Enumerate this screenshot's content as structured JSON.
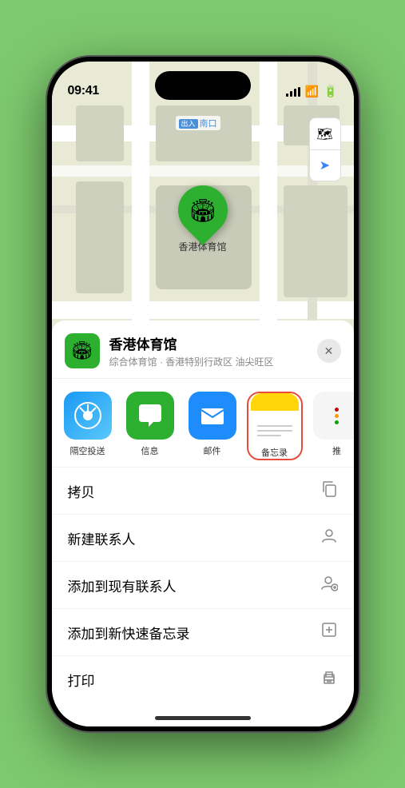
{
  "statusBar": {
    "time": "09:41",
    "timeIcon": "▶"
  },
  "mapLabel": "南口",
  "mapLabelPrefix": "出入",
  "locationPin": {
    "label": "香港体育馆",
    "emoji": "🏟"
  },
  "mapControls": {
    "mapIcon": "🗺",
    "locationIcon": "➤"
  },
  "locationHeader": {
    "name": "香港体育馆",
    "subtitle": "综合体育馆 · 香港特别行政区 油尖旺区",
    "closeLabel": "✕"
  },
  "shareApps": [
    {
      "id": "airdrop",
      "label": "隔空投送",
      "type": "airdrop"
    },
    {
      "id": "messages",
      "label": "信息",
      "type": "messages"
    },
    {
      "id": "mail",
      "label": "邮件",
      "type": "mail"
    },
    {
      "id": "notes",
      "label": "备忘录",
      "type": "notes",
      "selected": true
    },
    {
      "id": "more",
      "label": "推",
      "type": "more"
    }
  ],
  "actions": [
    {
      "id": "copy",
      "label": "拷贝",
      "icon": "⎘"
    },
    {
      "id": "new-contact",
      "label": "新建联系人",
      "icon": "👤"
    },
    {
      "id": "add-existing",
      "label": "添加到现有联系人",
      "icon": "👤"
    },
    {
      "id": "add-notes",
      "label": "添加到新快速备忘录",
      "icon": "🖊"
    },
    {
      "id": "print",
      "label": "打印",
      "icon": "🖨"
    }
  ]
}
